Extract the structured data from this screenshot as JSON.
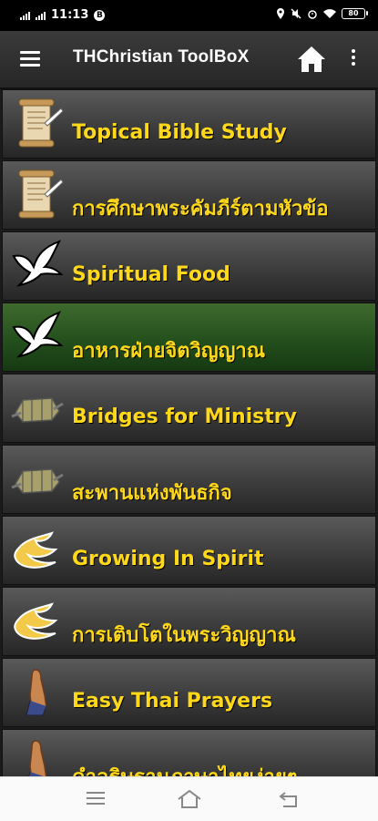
{
  "status_bar": {
    "time": "11:13",
    "battery": "80",
    "b_badge": "B"
  },
  "app_bar": {
    "title": "THChristian ToolBoX"
  },
  "items": [
    {
      "label": "Topical Bible Study",
      "icon": "scroll-icon"
    },
    {
      "label": "การศึกษาพระคัมภีร์ตามหัวข้อ",
      "icon": "scroll-icon"
    },
    {
      "label": "Spiritual Food",
      "icon": "dove-icon"
    },
    {
      "label": "อาหารฝ่ายจิตวิญญาณ",
      "icon": "dove-icon",
      "selected": true
    },
    {
      "label": "Bridges for Ministry",
      "icon": "bridge-icon"
    },
    {
      "label": "สะพานแห่งพันธกิจ",
      "icon": "bridge-icon"
    },
    {
      "label": "Growing In Spirit",
      "icon": "flame-icon"
    },
    {
      "label": "การเติบโตในพระวิญญาณ",
      "icon": "flame-icon"
    },
    {
      "label": "Easy Thai Prayers",
      "icon": "praying-hands-icon"
    },
    {
      "label": "คำอธิษฐานภาษาไทยง่ายๆ",
      "icon": "praying-hands-icon"
    }
  ],
  "colors": {
    "label": "#ffd81a",
    "selected_bg": "#24501d",
    "item_bg": "#3f3f3f"
  }
}
